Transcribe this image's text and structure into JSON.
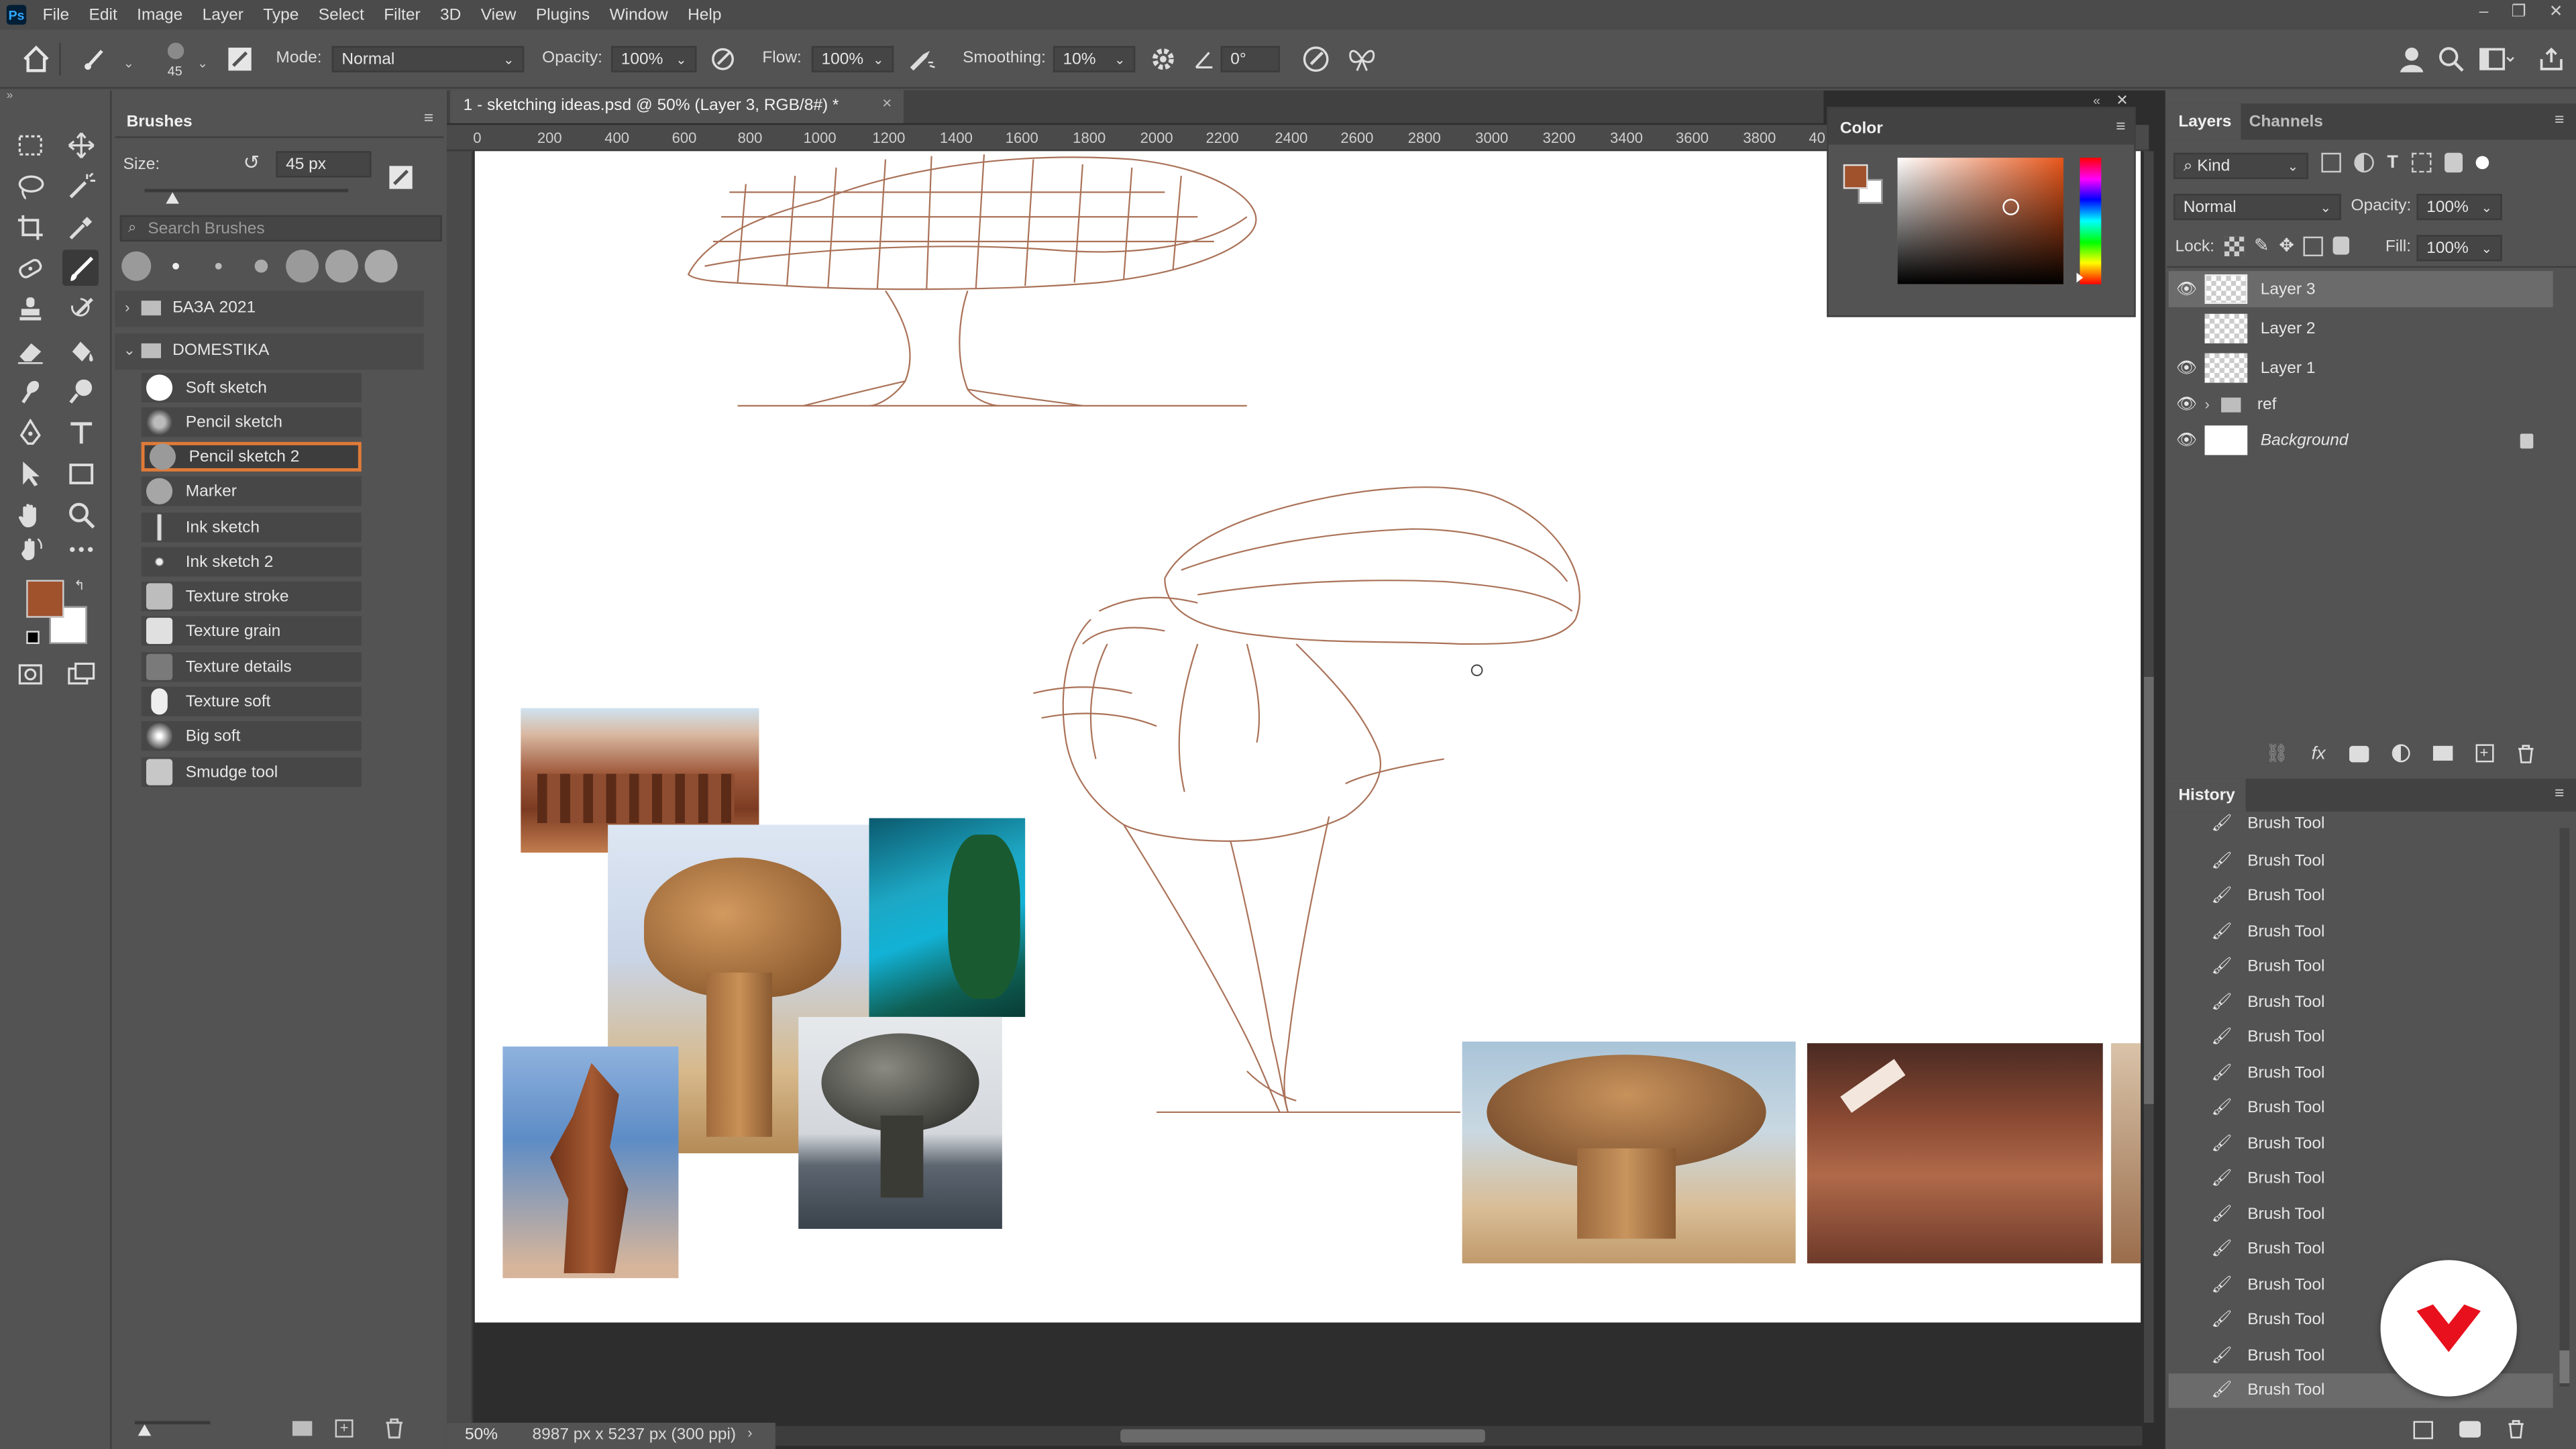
{
  "menu": {
    "logo": "Ps",
    "items": [
      "File",
      "Edit",
      "Image",
      "Layer",
      "Type",
      "Select",
      "Filter",
      "3D",
      "View",
      "Plugins",
      "Window",
      "Help"
    ]
  },
  "options": {
    "brush_size": "45",
    "mode_label": "Mode:",
    "mode_value": "Normal",
    "opacity_label": "Opacity:",
    "opacity_value": "100%",
    "flow_label": "Flow:",
    "flow_value": "100%",
    "smoothing_label": "Smoothing:",
    "smoothing_value": "10%",
    "angle_value": "0°"
  },
  "document": {
    "tab_title": "1 - sketching ideas.psd @ 50% (Layer 3, RGB/8#) *",
    "close": "×"
  },
  "ruler": {
    "h_ticks": [
      "0",
      "200",
      "400",
      "600",
      "800",
      "1000",
      "1200",
      "1400",
      "1600",
      "1800",
      "2000",
      "2200",
      "2400",
      "2600",
      "2800",
      "3000",
      "3200",
      "3400",
      "3600",
      "3800",
      "40"
    ]
  },
  "status": {
    "zoom": "50%",
    "dimensions": "8987 px x 5237 px (300 ppi)"
  },
  "brushes": {
    "title": "Brushes",
    "size_label": "Size:",
    "size_value": "45 px",
    "search_placeholder": "Search Brushes",
    "folders": [
      "БАЗА 2021",
      "DOMESTIKA"
    ],
    "items": [
      "Soft sketch",
      "Pencil sketch",
      "Pencil sketch 2",
      "Marker",
      "Ink sketch",
      "Ink sketch 2",
      "Texture stroke",
      "Texture grain",
      "Texture details",
      "Texture soft",
      "Big soft",
      "Smudge tool"
    ],
    "selected": "Pencil sketch 2"
  },
  "colors": {
    "foreground": "#a0522d",
    "background": "#ffffff",
    "accent": "#31a8ff",
    "selection": "#e07b39"
  },
  "color_panel": {
    "title": "Color"
  },
  "layers_panel": {
    "tabs": [
      "Layers",
      "Channels"
    ],
    "kind": "Kind",
    "blend": "Normal",
    "opacity_label": "Opacity:",
    "opacity_value": "100%",
    "lock_label": "Lock:",
    "fill_label": "Fill:",
    "fill_value": "100%",
    "layers": [
      {
        "name": "Layer 3",
        "visible": true,
        "selected": true
      },
      {
        "name": "Layer 2",
        "visible": false
      },
      {
        "name": "Layer 1",
        "visible": true
      },
      {
        "name": "ref",
        "visible": true,
        "group": true
      },
      {
        "name": "Background",
        "visible": true,
        "locked": true
      }
    ]
  },
  "history_panel": {
    "title": "History",
    "items": [
      "Brush Tool",
      "Brush Tool",
      "Brush Tool",
      "Brush Tool",
      "Brush Tool",
      "Brush Tool",
      "Brush Tool",
      "Brush Tool",
      "Brush Tool",
      "Brush Tool",
      "Brush Tool",
      "Brush Tool",
      "Brush Tool",
      "Brush Tool",
      "Brush Tool",
      "Brush Tool",
      "Brush Tool"
    ]
  }
}
